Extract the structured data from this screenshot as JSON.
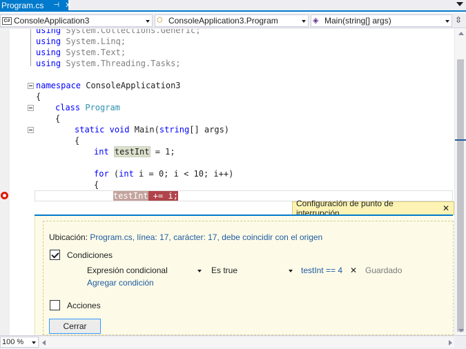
{
  "tab": {
    "title": "Program.cs",
    "pin_glyph": "⊣",
    "close_glyph": "✕"
  },
  "navbar": {
    "project": "ConsoleApplication3",
    "project_icon_text": "C#",
    "type": "ConsoleApplication3.Program",
    "member": "Main(string[] args)",
    "split_glyph": "⇳"
  },
  "code": {
    "lines": [
      {
        "kw": "using",
        "rest": " System.Collections.Generic;"
      },
      {
        "kw": "using",
        "rest": " System.Linq;"
      },
      {
        "kw": "using",
        "rest": " System.Text;"
      },
      {
        "kw": "using",
        "rest": " System.Threading.Tasks;"
      }
    ],
    "ns_kw": "namespace",
    "ns_name": " ConsoleApplication3",
    "brace_open": "{",
    "class_kw": "class",
    "class_name": "Program",
    "static_kw": "static",
    "void_kw": "void",
    "main_sig_a": " Main(",
    "string_kw": "string",
    "main_sig_b": "[] args)",
    "int_kw": "int",
    "var_name": "testInt",
    "assign_rest": " = 1;",
    "for_kw": "for",
    "for_a": " (",
    "for_b": " i = 0; i < 10; i++)",
    "bp_var": "testInt",
    "bp_rest": " += i;"
  },
  "peek": {
    "title": "Configuración de punto de interrupción",
    "close_glyph": "✕",
    "location_label": "Ubicación: ",
    "location_value": "Program.cs, línea: 17, carácter: 17, debe coincidir con el origen",
    "conditions_label": "Condiciones",
    "conditions_checked": true,
    "condition_type": "Expresión condicional",
    "condition_kind": "Es true",
    "condition_expr": "testInt == 4",
    "remove_glyph": "✕",
    "saved_text": "Guardado",
    "add_condition": "Agregar condición",
    "actions_label": "Acciones",
    "actions_checked": false,
    "close_button": "Cerrar"
  },
  "statusbar": {
    "zoom": "100 %"
  },
  "colors": {
    "accent": "#007acc",
    "breakpoint": "#e51400",
    "peek_header": "#fcf3b4",
    "link": "#1e5aa0"
  }
}
